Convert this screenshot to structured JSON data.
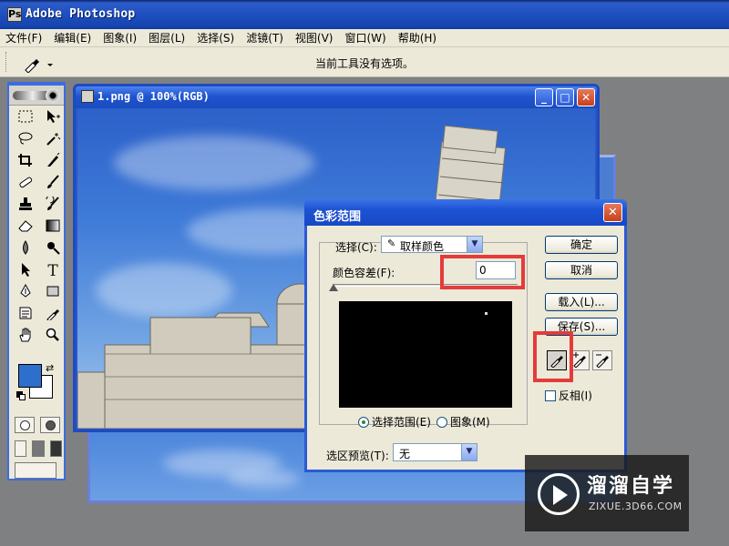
{
  "app": {
    "title": "Adobe Photoshop",
    "icon": "photoshop-app-icon"
  },
  "menubar": {
    "items": [
      "文件(F)",
      "编辑(E)",
      "图象(I)",
      "图层(L)",
      "选择(S)",
      "滤镜(T)",
      "视图(V)",
      "窗口(W)",
      "帮助(H)"
    ]
  },
  "options_bar": {
    "tool_icon": "eyedropper-icon",
    "message": "当前工具没有选项。"
  },
  "toolbox": {
    "foreground_color": "#2f6fcc",
    "background_color": "#ffffff",
    "tools": [
      "marquee-tool",
      "move-tool",
      "lasso-tool",
      "magic-wand-tool",
      "crop-tool",
      "slice-tool",
      "healing-brush-tool",
      "brush-tool",
      "clone-stamp-tool",
      "history-brush-tool",
      "eraser-tool",
      "gradient-tool",
      "blur-tool",
      "dodge-tool",
      "path-selection-tool",
      "type-tool",
      "pen-tool",
      "rectangle-tool",
      "notes-tool",
      "eyedropper-tool",
      "hand-tool",
      "zoom-tool"
    ],
    "type_tool_label": "T"
  },
  "document": {
    "title": "1.png @ 100%(RGB)",
    "minimize": "_",
    "maximize": "□",
    "close": "✕"
  },
  "color_range_dialog": {
    "title": "色彩范围",
    "close": "✕",
    "select_label": "选择(C):",
    "select_value": "取样颜色",
    "fuzziness_label": "颜色容差(F):",
    "fuzziness_value": "0",
    "fuzziness_level": 0,
    "radio_selection": "选择范围(E)",
    "radio_image": "图象(M)",
    "radio_selected": "selection",
    "preview_label": "选区预览(T):",
    "preview_value": "无",
    "buttons": {
      "ok": "确定",
      "cancel": "取消",
      "load": "载入(L)...",
      "save": "保存(S)..."
    },
    "eyedroppers": [
      "eyedropper-icon",
      "add-to-sample-eyedropper-icon",
      "subtract-from-sample-eyedropper-icon"
    ],
    "invert_label": "反相(I)",
    "invert_checked": false
  },
  "highlights": {
    "color": "#e53b3b"
  },
  "watermark": {
    "title": "溜溜自学",
    "subtitle": "ZIXUE.3D66.COM"
  }
}
